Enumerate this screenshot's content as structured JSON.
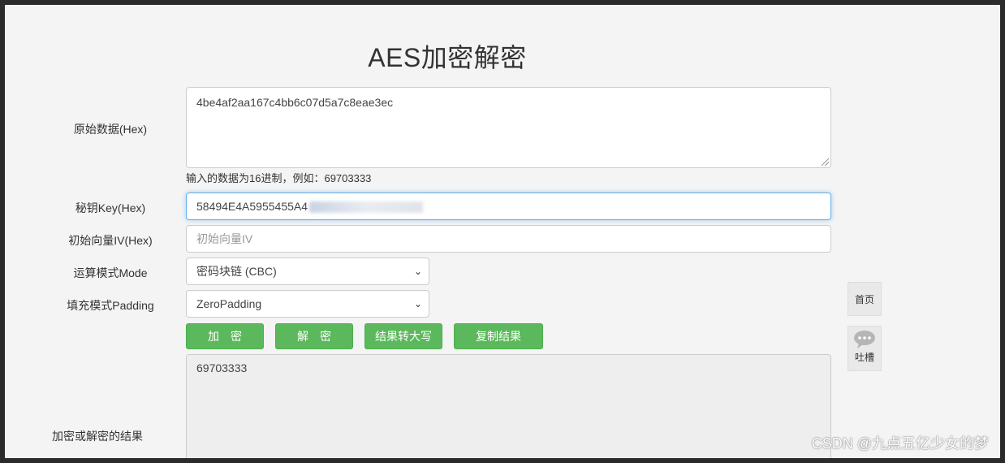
{
  "page": {
    "title": "AES加密解密"
  },
  "form": {
    "raw_label": "原始数据(Hex)",
    "raw_value": "4be4af2aa167c4bb6c07d5a7c8eae3ec",
    "raw_hint": "输入的数据为16进制，例如：69703333",
    "key_label": "秘钥Key(Hex)",
    "key_value": "58494E4A5955455A4",
    "iv_label": "初始向量IV(Hex)",
    "iv_placeholder": "初始向量IV",
    "mode_label": "运算模式Mode",
    "mode_value": "密码块链 (CBC)",
    "padding_label": "填充模式Padding",
    "padding_value": "ZeroPadding",
    "result_label": "加密或解密的结果",
    "result_value": "69703333"
  },
  "buttons": {
    "encrypt": "加　密",
    "decrypt": "解　密",
    "uppercase": "结果转大写",
    "copy": "复制结果"
  },
  "side": {
    "home": "首页",
    "feedback": "吐槽"
  },
  "watermark": "CSDN @九点五亿少女的梦",
  "colors": {
    "button_green": "#5cb85c",
    "focus_blue": "#66afe9"
  }
}
